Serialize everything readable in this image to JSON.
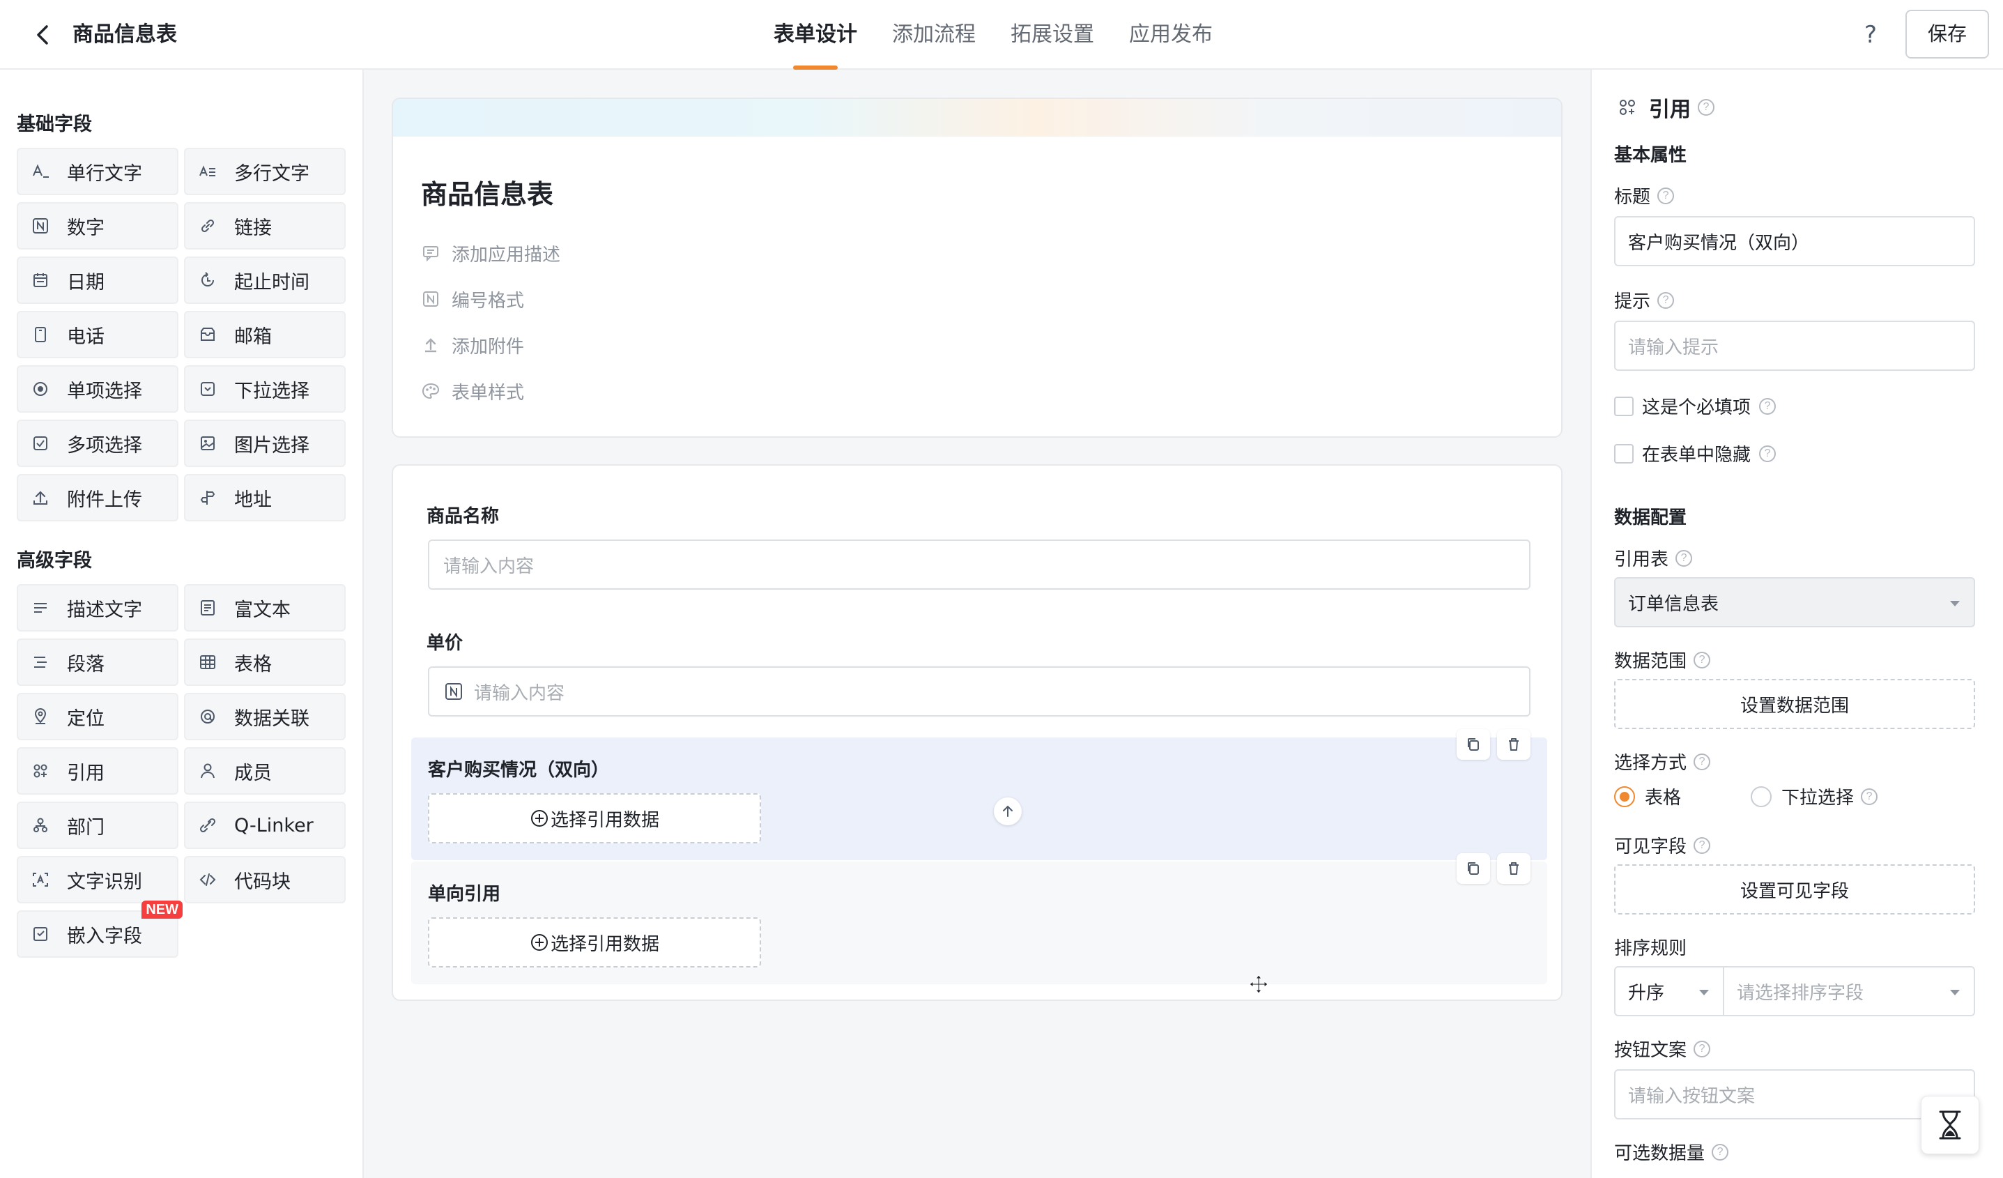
{
  "header": {
    "title": "商品信息表",
    "tabs": [
      {
        "label": "表单设计",
        "active": true
      },
      {
        "label": "添加流程",
        "active": false
      },
      {
        "label": "拓展设置",
        "active": false
      },
      {
        "label": "应用发布",
        "active": false
      }
    ],
    "help_label": "?",
    "save_label": "保存",
    "accent_color": "#f0882f"
  },
  "sidebar": {
    "basic_title": "基础字段",
    "basic_fields": [
      {
        "label": "单行文字",
        "icon": "single-line-text-icon"
      },
      {
        "label": "多行文字",
        "icon": "multi-line-text-icon"
      },
      {
        "label": "数字",
        "icon": "number-icon"
      },
      {
        "label": "链接",
        "icon": "link-icon"
      },
      {
        "label": "日期",
        "icon": "calendar-icon"
      },
      {
        "label": "起止时间",
        "icon": "time-range-icon"
      },
      {
        "label": "电话",
        "icon": "phone-icon"
      },
      {
        "label": "邮箱",
        "icon": "mail-icon"
      },
      {
        "label": "单项选择",
        "icon": "radio-icon"
      },
      {
        "label": "下拉选择",
        "icon": "dropdown-icon"
      },
      {
        "label": "多项选择",
        "icon": "checkbox-icon"
      },
      {
        "label": "图片选择",
        "icon": "image-icon"
      },
      {
        "label": "附件上传",
        "icon": "upload-icon"
      },
      {
        "label": "地址",
        "icon": "address-icon"
      }
    ],
    "advanced_title": "高级字段",
    "advanced_fields": [
      {
        "label": "描述文字",
        "icon": "description-icon"
      },
      {
        "label": "富文本",
        "icon": "rich-text-icon"
      },
      {
        "label": "段落",
        "icon": "paragraph-icon"
      },
      {
        "label": "表格",
        "icon": "table-icon"
      },
      {
        "label": "定位",
        "icon": "location-icon"
      },
      {
        "label": "数据关联",
        "icon": "data-link-icon"
      },
      {
        "label": "引用",
        "icon": "reference-icon"
      },
      {
        "label": "成员",
        "icon": "member-icon"
      },
      {
        "label": "部门",
        "icon": "department-icon"
      },
      {
        "label": "Q-Linker",
        "icon": "q-linker-icon"
      },
      {
        "label": "文字识别",
        "icon": "ocr-icon"
      },
      {
        "label": "代码块",
        "icon": "code-icon"
      },
      {
        "label": "嵌入字段",
        "icon": "embed-icon",
        "badge": "NEW"
      }
    ]
  },
  "canvas": {
    "form_title": "商品信息表",
    "meta_items": [
      {
        "label": "添加应用描述",
        "icon": "comment-icon"
      },
      {
        "label": "编号格式",
        "icon": "number-format-icon"
      },
      {
        "label": "添加附件",
        "icon": "upload-icon"
      },
      {
        "label": "表单样式",
        "icon": "palette-icon"
      }
    ],
    "fields": {
      "name_label": "商品名称",
      "name_placeholder": "请输入内容",
      "price_label": "单价",
      "price_placeholder": "请输入内容",
      "ref_two_way_label": "客户购买情况（双向）",
      "ref_one_way_label": "单向引用",
      "pick_label": "选择引用数据"
    }
  },
  "panel": {
    "title": "引用",
    "basic_section": "基本属性",
    "title_label": "标题",
    "title_value": "客户购买情况（双向）",
    "hint_label": "提示",
    "hint_placeholder": "请输入提示",
    "required_label": "这是个必填项",
    "hidden_label": "在表单中隐藏",
    "data_section": "数据配置",
    "ref_table_label": "引用表",
    "ref_table_value": "订单信息表",
    "data_range_label": "数据范围",
    "data_range_button": "设置数据范围",
    "select_mode_label": "选择方式",
    "select_mode_options": [
      "表格",
      "下拉选择"
    ],
    "select_mode_selected": "表格",
    "visible_fields_label": "可见字段",
    "visible_fields_button": "设置可见字段",
    "sort_label": "排序规则",
    "sort_order": "升序",
    "sort_field_placeholder": "请选择排序字段",
    "button_text_label": "按钮文案",
    "button_text_placeholder": "请输入按钮文案",
    "max_count_label": "可选数据量"
  }
}
